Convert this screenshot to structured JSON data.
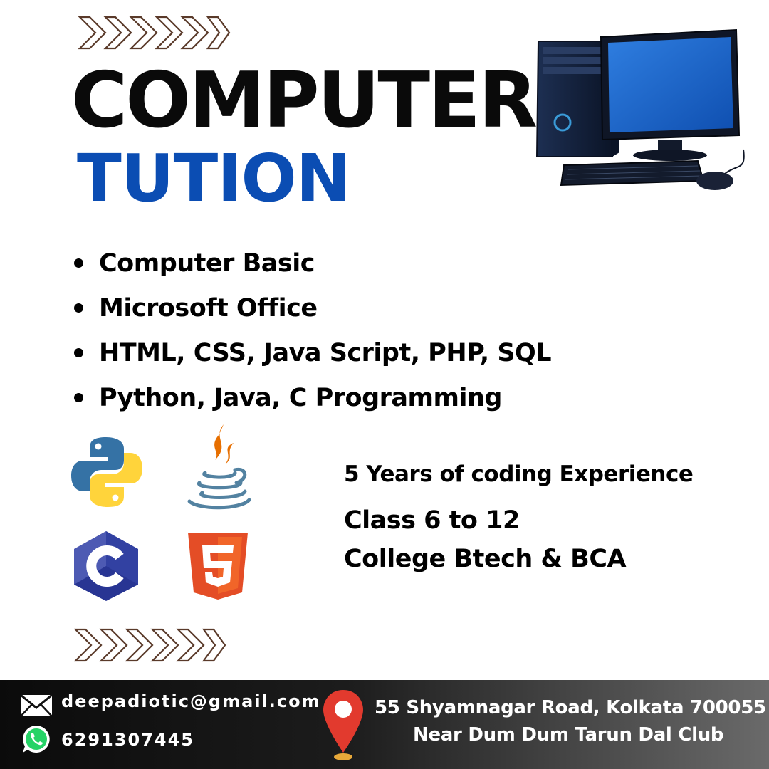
{
  "header": {
    "title_line1": "COMPUTER",
    "title_line2": "TUTION"
  },
  "courses": [
    "Computer Basic",
    "Microsoft Office",
    "HTML, CSS, Java Script, PHP, SQL",
    "Python, Java, C Programming"
  ],
  "info": {
    "experience": "5 Years of coding Experience",
    "classes": "Class 6  to 12",
    "college": "College Btech & BCA"
  },
  "footer": {
    "email": "deepadiotic@gmail.com",
    "phone": "6291307445",
    "address_line1": "55 Shyamnagar Road, Kolkata 700055",
    "address_line2": "Near Dum Dum Tarun Dal Club"
  },
  "colors": {
    "title_dark": "#0a0a0a",
    "title_accent": "#0b4db3",
    "chevron": "#5a3a2a",
    "pin": "#e23a2e",
    "footer_bg": "#111111"
  },
  "icons": [
    "chevron-right-icon",
    "desktop-computer-icon",
    "python-logo-icon",
    "java-logo-icon",
    "c-language-logo-icon",
    "html5-logo-icon",
    "mail-icon",
    "whatsapp-icon",
    "location-pin-icon"
  ]
}
